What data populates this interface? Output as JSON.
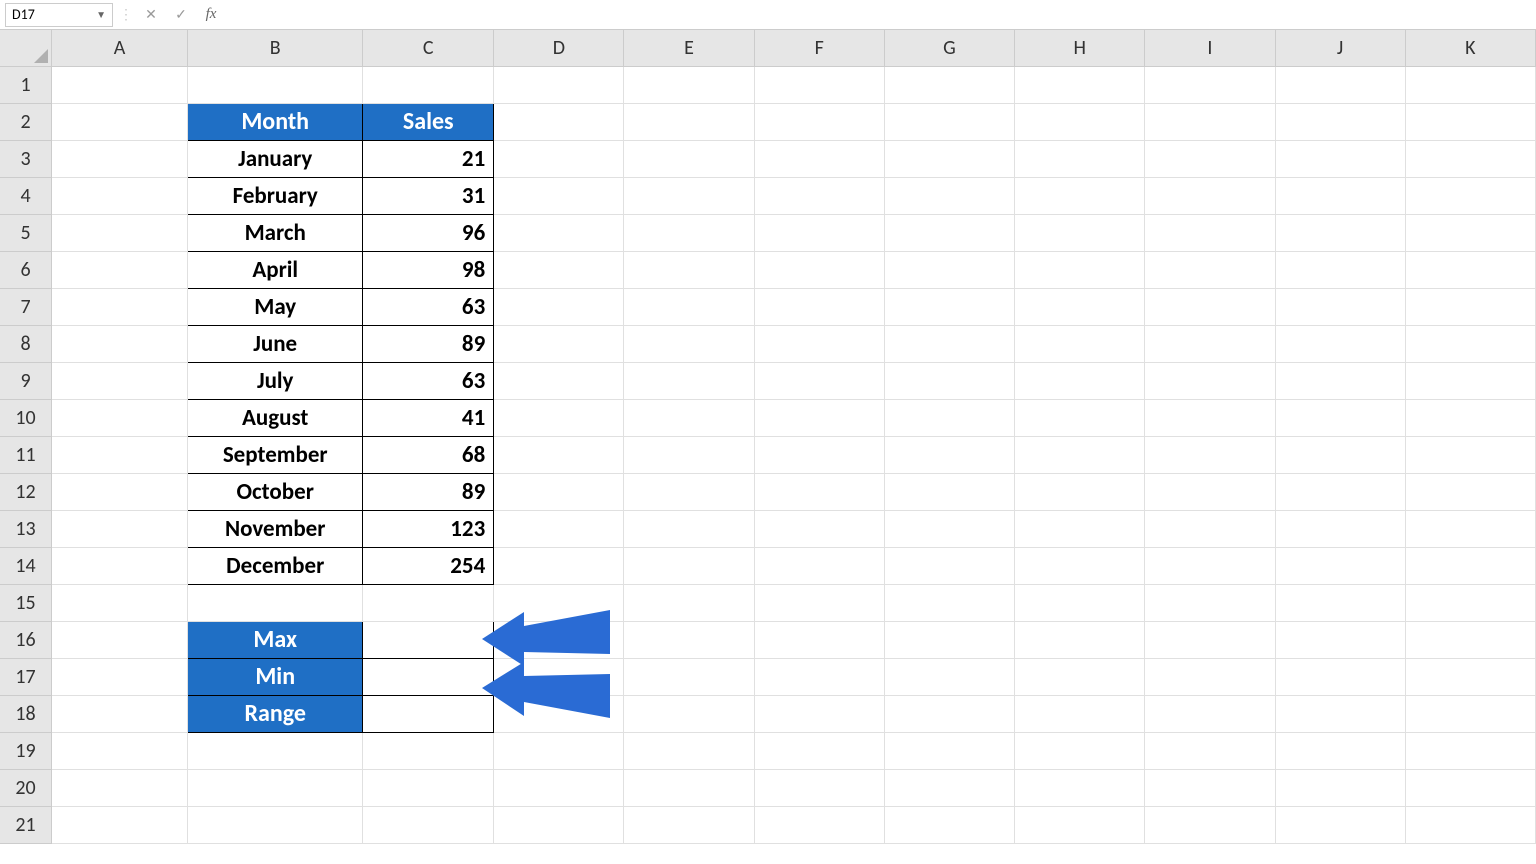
{
  "nameBox": "D17",
  "formula": "",
  "columns": [
    "A",
    "B",
    "C",
    "D",
    "E",
    "F",
    "G",
    "H",
    "I",
    "J",
    "K"
  ],
  "rowCount": 21,
  "headers": {
    "month": "Month",
    "sales": "Sales"
  },
  "data": [
    {
      "month": "January",
      "sales": "21"
    },
    {
      "month": "February",
      "sales": "31"
    },
    {
      "month": "March",
      "sales": "96"
    },
    {
      "month": "April",
      "sales": "98"
    },
    {
      "month": "May",
      "sales": "63"
    },
    {
      "month": "June",
      "sales": "89"
    },
    {
      "month": "July",
      "sales": "63"
    },
    {
      "month": "August",
      "sales": "41"
    },
    {
      "month": "September",
      "sales": "68"
    },
    {
      "month": "October",
      "sales": "89"
    },
    {
      "month": "November",
      "sales": "123"
    },
    {
      "month": "December",
      "sales": "254"
    }
  ],
  "summary": {
    "max": {
      "label": "Max",
      "value": ""
    },
    "min": {
      "label": "Min",
      "value": ""
    },
    "range": {
      "label": "Range",
      "value": ""
    }
  },
  "colors": {
    "accent": "#1f6fc5",
    "arrow": "#2a6bd4"
  }
}
